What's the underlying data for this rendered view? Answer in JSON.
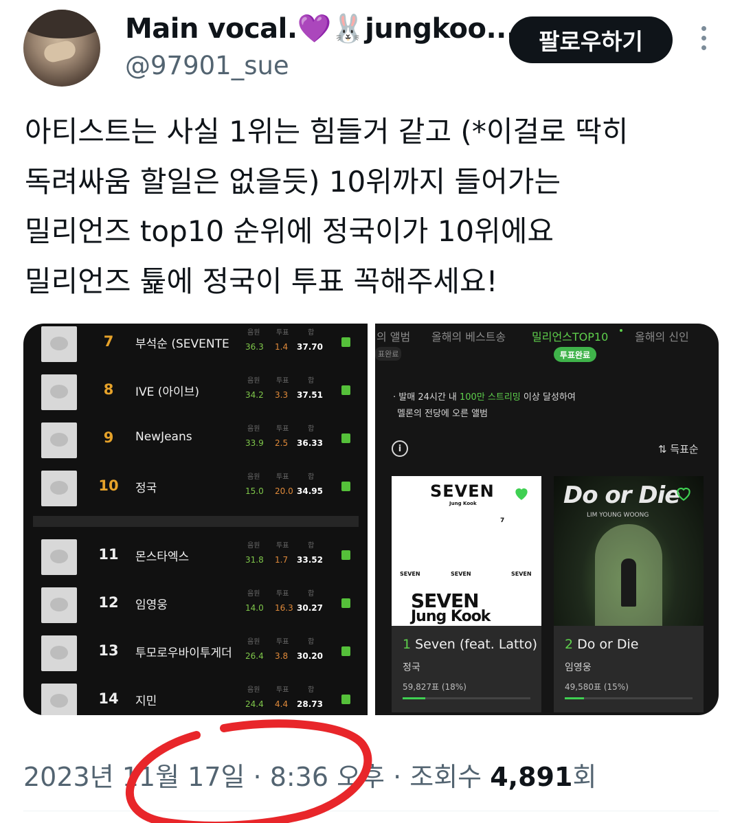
{
  "author": {
    "display_name": "Main vocal.💜🐰jungkoo...",
    "handle": "@97901_sue",
    "follow_label": "팔로우하기"
  },
  "tweet": {
    "lines": [
      "아티스트는 사실 1위는 힘들거 같고 (*이걸로 딱히",
      "독려싸움 할일은 없을듯) 10위까지 들어가는",
      "밀리언즈 top10 순위에 정국이가 10위에요",
      "밀리언즈 튩에 정국이 투표 꼭해주세요!"
    ]
  },
  "ranking_panel": {
    "column_labels": [
      "음원",
      "투표",
      "합"
    ],
    "rows": [
      {
        "rank": "7",
        "name": "부석순 (SEVENTE",
        "a": "36.3",
        "b": "1.4",
        "c": "37.70"
      },
      {
        "rank": "8",
        "name": "IVE (아이브)",
        "a": "34.2",
        "b": "3.3",
        "c": "37.51"
      },
      {
        "rank": "9",
        "name": "NewJeans",
        "a": "33.9",
        "b": "2.5",
        "c": "36.33"
      },
      {
        "rank": "10",
        "name": "정국",
        "a": "15.0",
        "b": "20.0",
        "c": "34.95"
      },
      {
        "rank": "11",
        "name": "몬스타엑스",
        "a": "31.8",
        "b": "1.7",
        "c": "33.52"
      },
      {
        "rank": "12",
        "name": "임영웅",
        "a": "14.0",
        "b": "16.3",
        "c": "30.27"
      },
      {
        "rank": "13",
        "name": "투모로우바이투게더",
        "a": "26.4",
        "b": "3.8",
        "c": "30.20"
      },
      {
        "rank": "14",
        "name": "지민",
        "a": "24.4",
        "b": "4.4",
        "c": "28.73"
      }
    ]
  },
  "album_panel": {
    "tabs": [
      "의 앨범",
      "올해의 베스트송",
      "밀리언스TOP10",
      "올해의 신인"
    ],
    "sub_badge": "표완료",
    "done_badge": "투표완료",
    "desc_prefix": "발매 24시간 내 ",
    "desc_highlight": "100만 스트리밍",
    "desc_suffix": " 이상 달성하여",
    "desc_line2": "멜론의 전당에 오른 앨범",
    "info_icon": "i",
    "sort_label": "⇅ 득표순",
    "cards": [
      {
        "rank": "1",
        "title": "Seven (feat. Latto)",
        "artist": "정국",
        "votes": "59,827표 (18%)",
        "share": 0.18,
        "cover": {
          "t1": "SEVEN",
          "t2": "Jung Kook",
          "t3": "7",
          "row_left": "SEVEN",
          "row_mid": "SEVEN",
          "row_right": "SEVEN",
          "big": "SEVEN",
          "big2": "Jung Kook"
        }
      },
      {
        "rank": "2",
        "title": "Do or Die",
        "artist": "임영웅",
        "votes": "49,580표 (15%)",
        "share": 0.15,
        "cover": {
          "logo": "Do or Die",
          "sub": "LIM YOUNG WOONG"
        }
      }
    ]
  },
  "footer": {
    "date_time": "2023년 11월 17일 · 8:36 오후 · ",
    "views_label": "조회수 ",
    "views_count": "4,891",
    "views_unit": "회"
  },
  "colors": {
    "accent_green": "#5ed04c",
    "rank_gold": "#e6a22a",
    "annotation_red": "#e8262a"
  }
}
